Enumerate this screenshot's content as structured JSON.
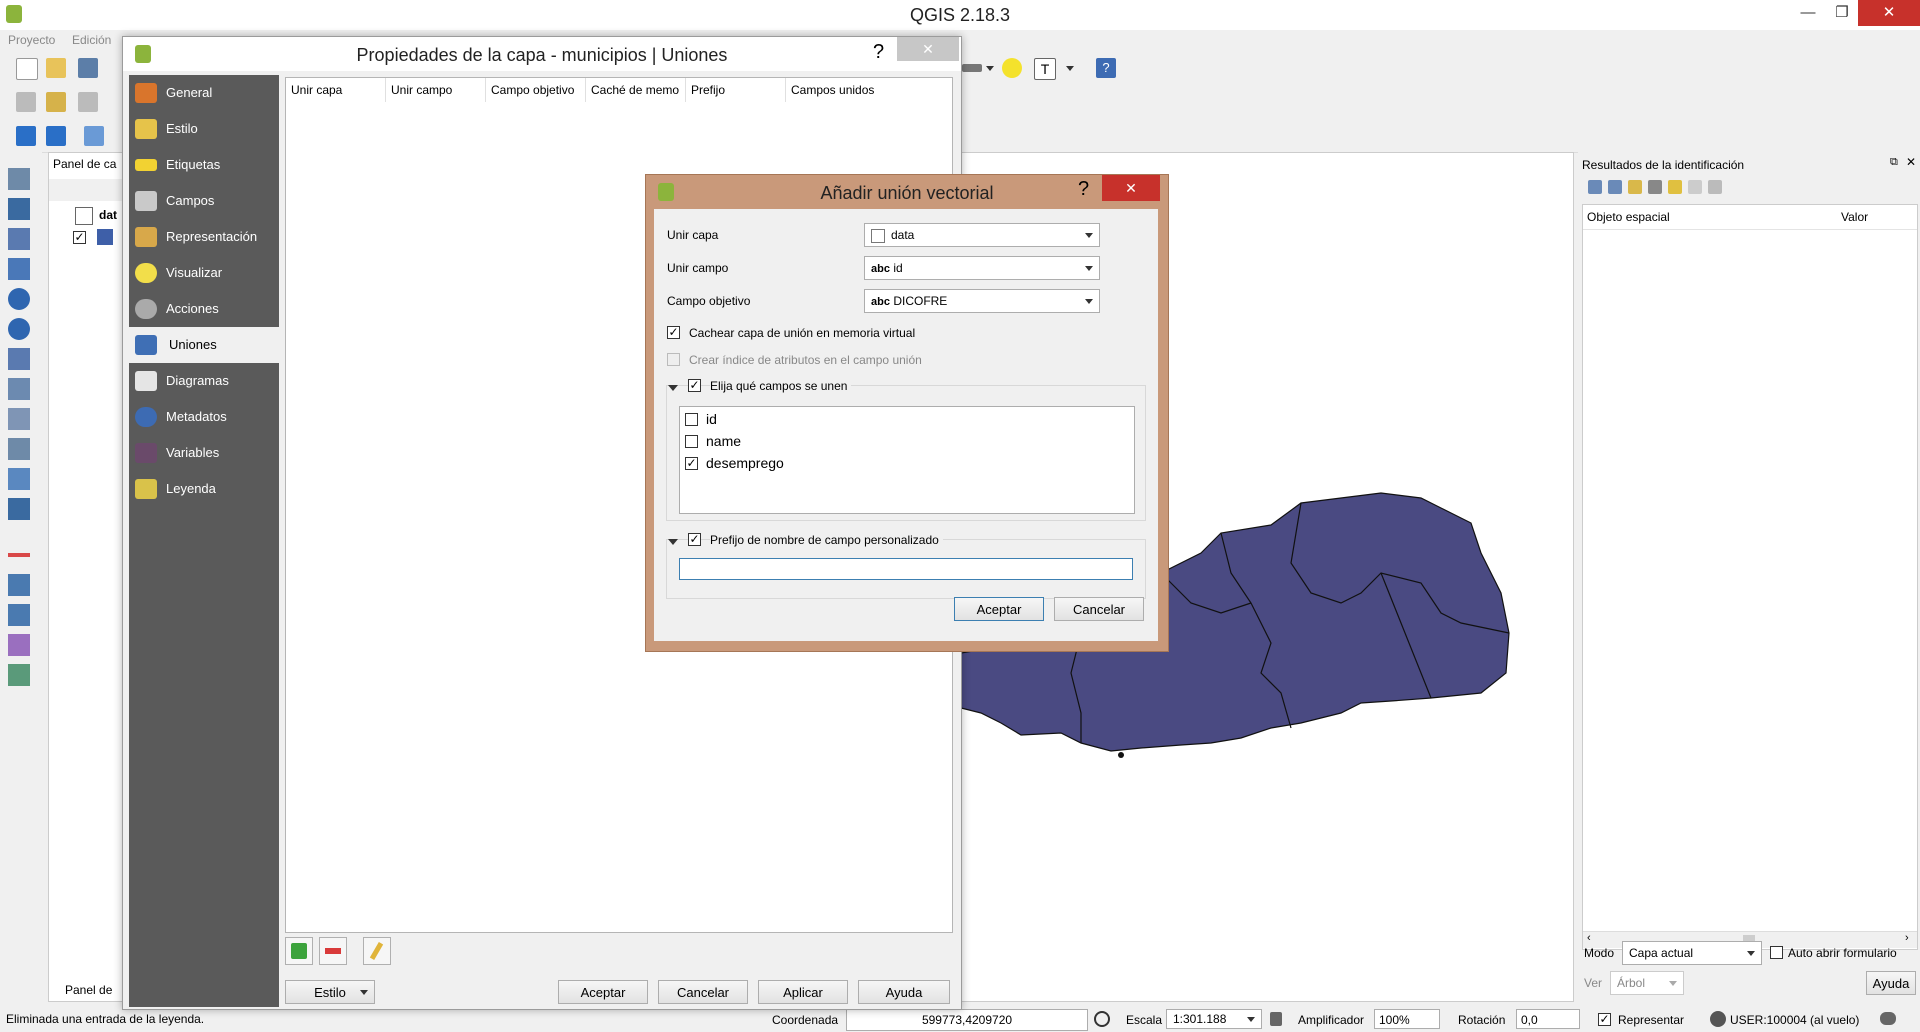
{
  "app": {
    "title": "QGIS 2.18.3"
  },
  "menu": {
    "items": [
      "Proyecto",
      "Edición"
    ]
  },
  "layers_panel": {
    "title": "Panel de ca",
    "layer_name": "dat",
    "bottom_tab": "Panel de"
  },
  "identify_panel": {
    "title": "Resultados de la identificación",
    "columns": [
      "Objeto espacial",
      "Valor"
    ],
    "mode_label": "Modo",
    "mode_value": "Capa actual",
    "auto_open_label": "Auto abrir formulario",
    "view_label": "Ver",
    "view_value": "Árbol",
    "help_button": "Ayuda"
  },
  "properties_dialog": {
    "title": "Propiedades de la capa - municipios | Uniones",
    "help": "?",
    "close": "✕",
    "nav": [
      {
        "label": "General",
        "icon": "wrench-icon"
      },
      {
        "label": "Estilo",
        "icon": "style-icon"
      },
      {
        "label": "Etiquetas",
        "icon": "labels-icon"
      },
      {
        "label": "Campos",
        "icon": "fields-icon"
      },
      {
        "label": "Representación",
        "icon": "rendering-icon"
      },
      {
        "label": "Visualizar",
        "icon": "display-icon"
      },
      {
        "label": "Acciones",
        "icon": "actions-icon"
      },
      {
        "label": "Uniones",
        "icon": "joins-icon"
      },
      {
        "label": "Diagramas",
        "icon": "diagrams-icon"
      },
      {
        "label": "Metadatos",
        "icon": "metadata-icon"
      },
      {
        "label": "Variables",
        "icon": "variables-icon"
      },
      {
        "label": "Leyenda",
        "icon": "legend-icon"
      }
    ],
    "selected_nav": "Uniones",
    "table_columns": [
      "Unir capa",
      "Unir campo",
      "Campo objetivo",
      "Caché de memo",
      "Prefijo",
      "Campos unidos"
    ],
    "style_button": "Estilo",
    "buttons": {
      "ok": "Aceptar",
      "cancel": "Cancelar",
      "apply": "Aplicar",
      "help": "Ayuda"
    }
  },
  "join_dialog": {
    "title": "Añadir unión vectorial",
    "help": "?",
    "close": "✕",
    "join_layer_label": "Unir capa",
    "join_layer_value": "data",
    "join_field_label": "Unir campo",
    "join_field_prefix": "abc",
    "join_field_value": "id",
    "target_field_label": "Campo objetivo",
    "target_field_prefix": "abc",
    "target_field_value": "DICOFRE",
    "cache_label": "Cachear capa de unión en memoria virtual",
    "cache_checked": true,
    "index_label": "Crear índice de atributos en el campo unión",
    "choose_fields_label": "Elija qué campos se unen",
    "fields": [
      {
        "name": "id",
        "checked": false
      },
      {
        "name": "name",
        "checked": false
      },
      {
        "name": "desemprego",
        "checked": true
      }
    ],
    "prefix_label": "Prefijo de nombre de campo personalizado",
    "prefix_value": "",
    "ok": "Aceptar",
    "cancel": "Cancelar"
  },
  "status": {
    "message": "Eliminada una entrada de la leyenda.",
    "coord_label": "Coordenada",
    "coord_value": "599773,4209720",
    "scale_label": "Escala",
    "scale_value": "1:301.188",
    "magnifier_label": "Amplificador",
    "magnifier_value": "100%",
    "rotation_label": "Rotación",
    "rotation_value": "0,0",
    "render_label": "Representar",
    "crs_label": "USER:100004 (al vuelo)"
  },
  "colors": {
    "map_fill": "#4a4a82",
    "join_frame": "#c9997a",
    "nav_bg": "#5a5a5a",
    "close_red": "#c7312b"
  }
}
